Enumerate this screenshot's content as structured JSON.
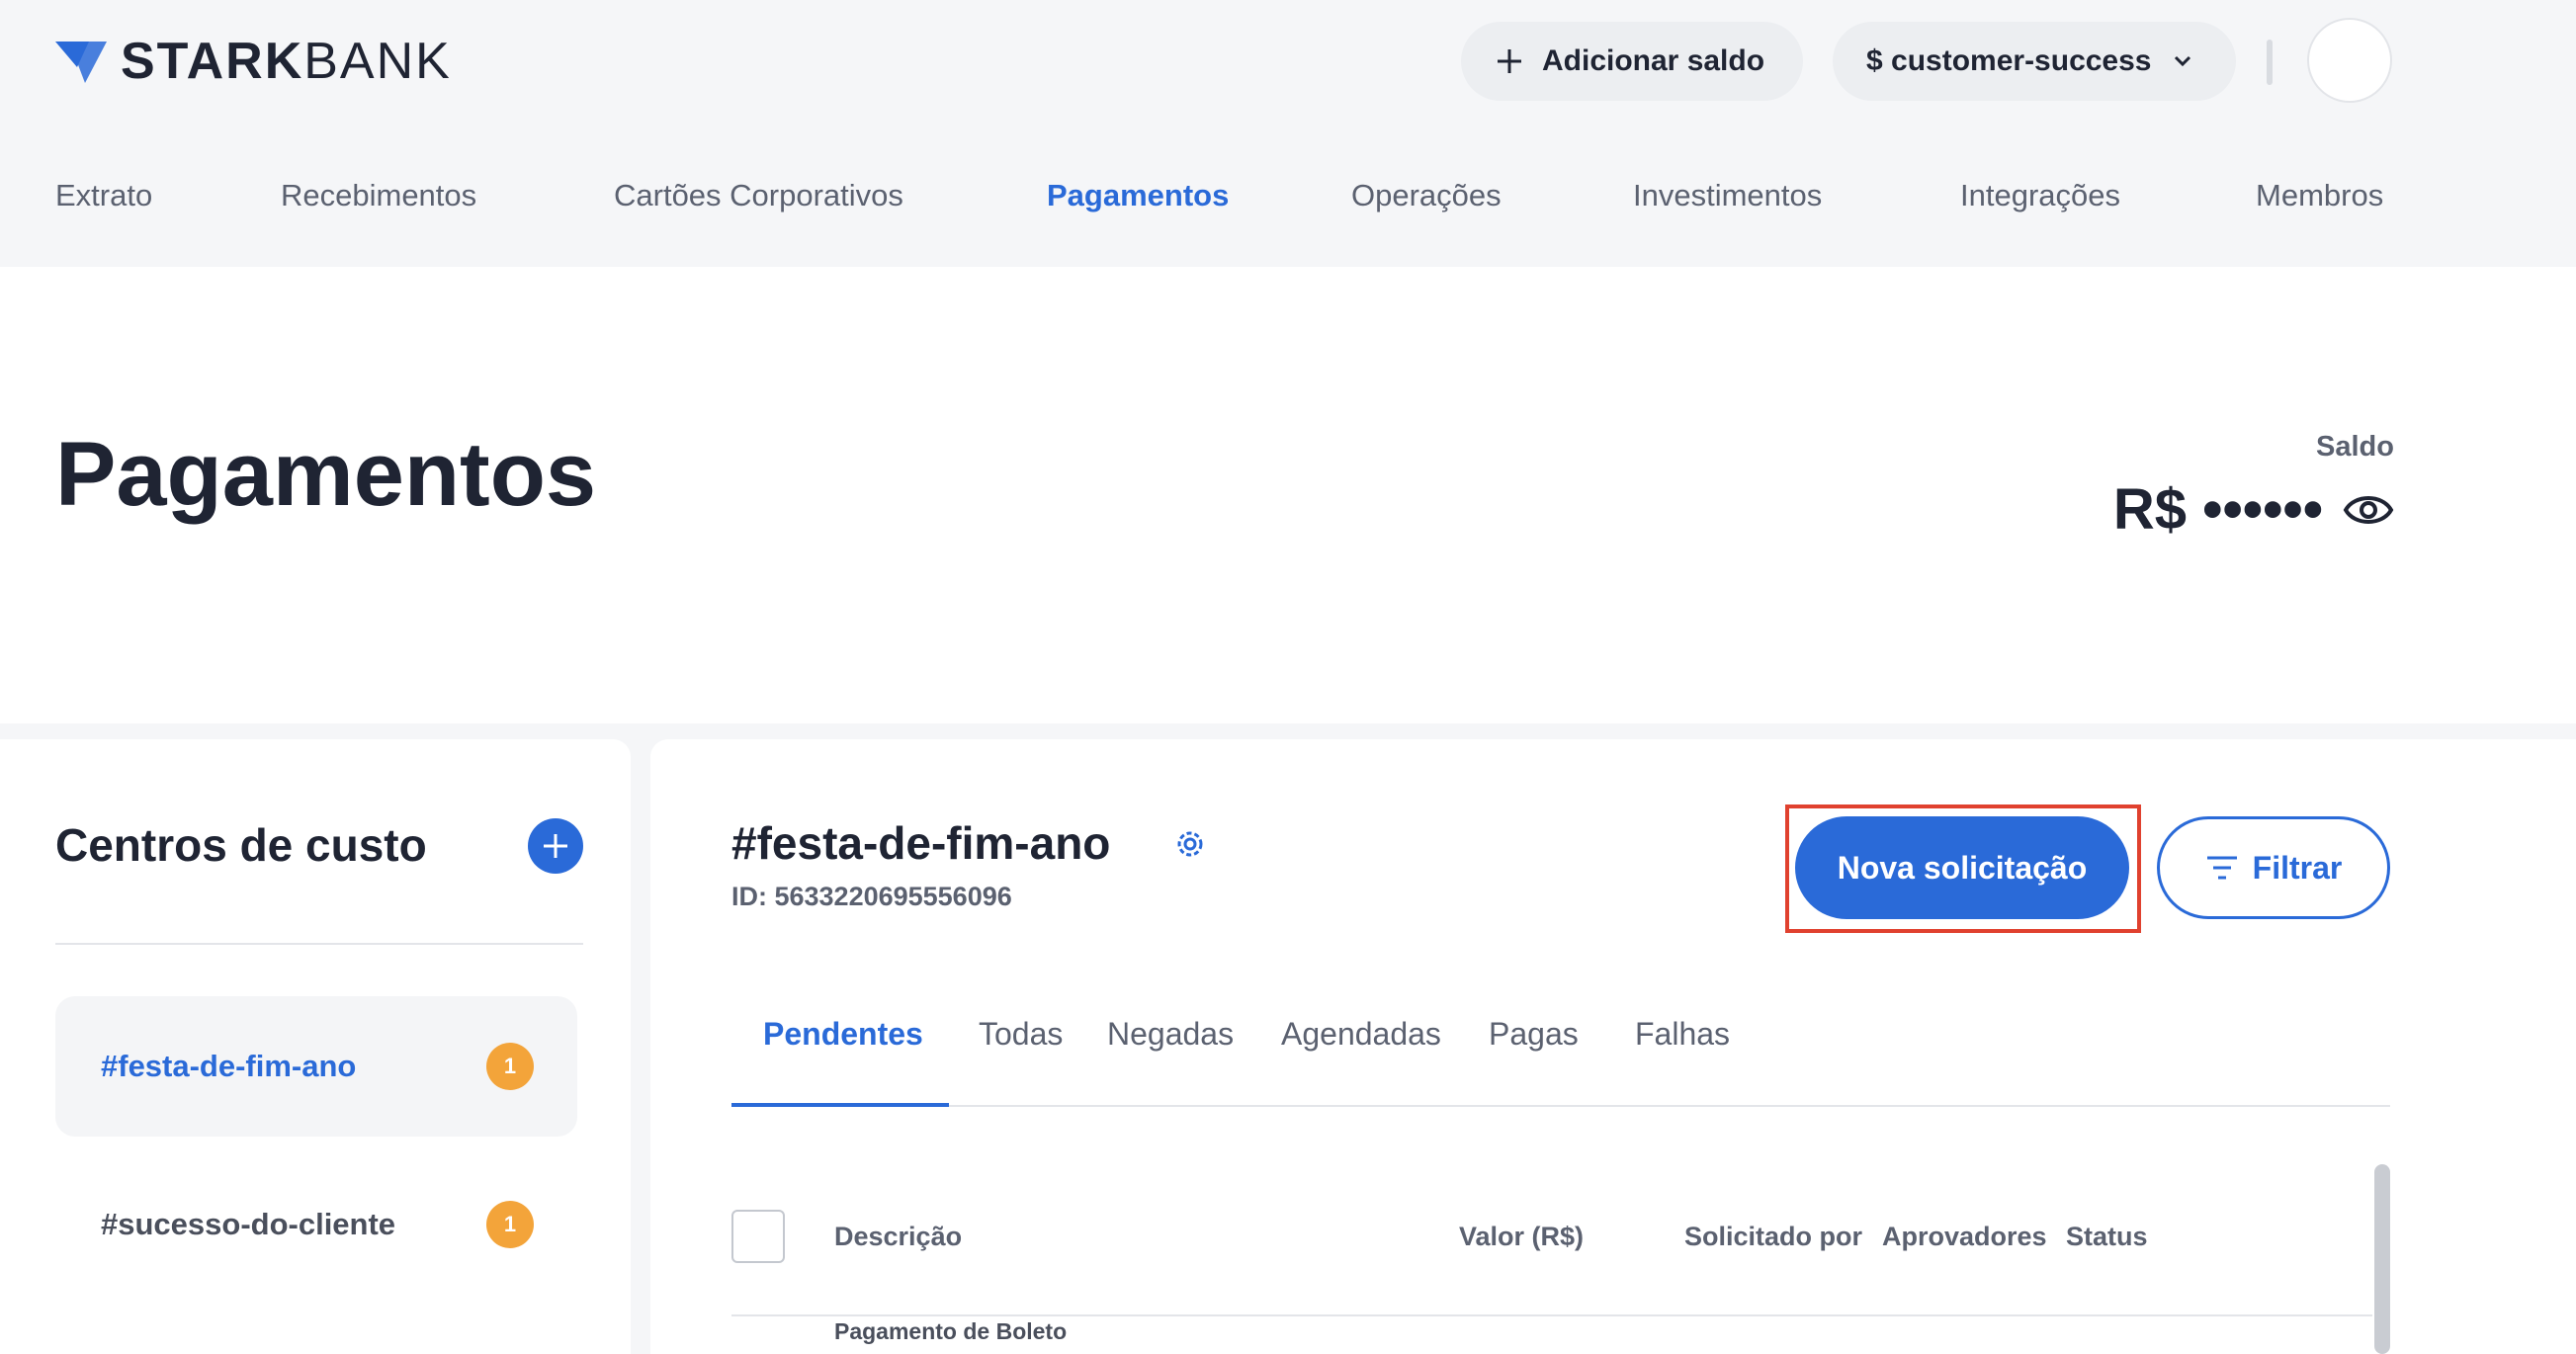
{
  "header": {
    "logo_bold": "STARK",
    "logo_light": "BANK",
    "add_balance_label": "Adicionar saldo",
    "workspace_label": "$ customer-success"
  },
  "nav": {
    "items": [
      {
        "label": "Extrato"
      },
      {
        "label": "Recebimentos"
      },
      {
        "label": "Cartões Corporativos"
      },
      {
        "label": "Pagamentos"
      },
      {
        "label": "Operações"
      },
      {
        "label": "Investimentos"
      },
      {
        "label": "Integrações"
      },
      {
        "label": "Membros"
      }
    ],
    "active": "Pagamentos"
  },
  "page": {
    "title": "Pagamentos",
    "balance_label": "Saldo",
    "balance_value": "R$ ••••••"
  },
  "sidebar": {
    "title": "Centros de custo",
    "items": [
      {
        "label": "#festa-de-fim-ano",
        "count": "1"
      },
      {
        "label": "#sucesso-do-cliente",
        "count": "1"
      }
    ]
  },
  "main": {
    "title": "#festa-de-fim-ano",
    "id_text": "ID: 5633220695556096",
    "new_request_label": "Nova solicitação",
    "filter_label": "Filtrar",
    "tabs": [
      {
        "label": "Pendentes"
      },
      {
        "label": "Todas"
      },
      {
        "label": "Negadas"
      },
      {
        "label": "Agendadas"
      },
      {
        "label": "Pagas"
      },
      {
        "label": "Falhas"
      }
    ],
    "columns": {
      "description": "Descrição",
      "value": "Valor (R$)",
      "requested_by": "Solicitado por",
      "approvers": "Aprovadores",
      "status": "Status"
    },
    "rows": [
      {
        "description": "Pagamento de Boleto"
      }
    ]
  },
  "colors": {
    "accent": "#2a6ad8",
    "badge": "#f3a43a",
    "highlight": "#e0412f"
  }
}
